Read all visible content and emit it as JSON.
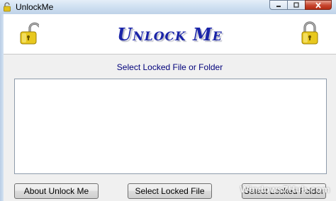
{
  "window": {
    "title": "UnlockMe",
    "controls": {
      "minimize_icon": "minimize-icon",
      "maximize_icon": "maximize-icon",
      "close_icon": "close-icon"
    }
  },
  "header": {
    "heading": "Unlock Me",
    "left_icon": "unlocked-padlock-icon",
    "right_icon": "locked-padlock-icon",
    "heading_color": "#1a24a8"
  },
  "main": {
    "subheading": "Select Locked File or Folder",
    "list_items": []
  },
  "buttons": {
    "about": "About Unlock Me",
    "select_file": "Select Locked File",
    "select_folder": "Select Locked Folder"
  },
  "watermark": "Windows7Hub.com"
}
